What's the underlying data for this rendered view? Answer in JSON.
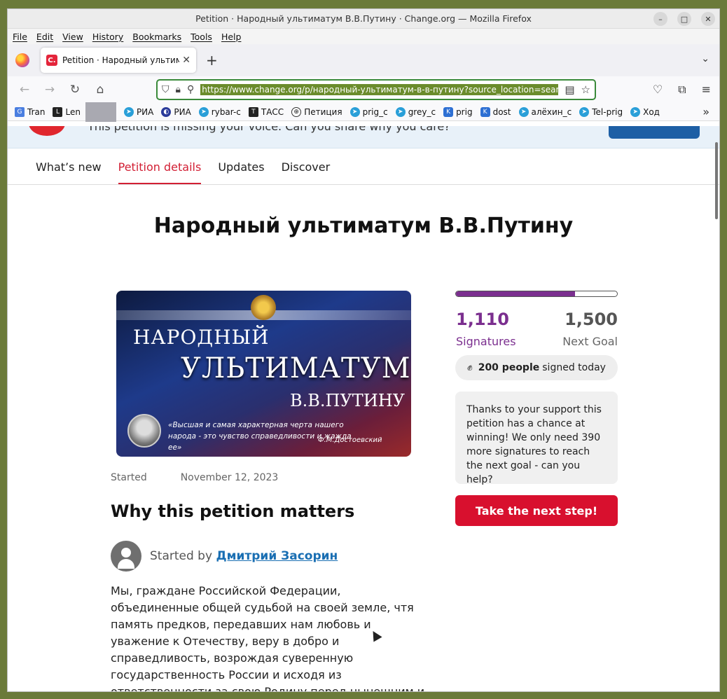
{
  "window": {
    "title": "Petition · Народный ультиматум В.В.Путину · Change.org — Mozilla Firefox"
  },
  "menu": [
    "File",
    "Edit",
    "View",
    "History",
    "Bookmarks",
    "Tools",
    "Help"
  ],
  "tab": {
    "title": "Petition · Народный ультимат"
  },
  "urlbar": {
    "url": "https://www.change.org/p/народный-ультиматум-в-в-путину?source_location=sear"
  },
  "bookmarks": [
    {
      "label": "Tran",
      "icon": "google-translate-icon"
    },
    {
      "label": "Len",
      "icon": "l-icon"
    },
    {
      "label": "РИА",
      "icon": "telegram-icon"
    },
    {
      "label": "РИА",
      "icon": "ria-icon"
    },
    {
      "label": "rybar-c",
      "icon": "telegram-icon"
    },
    {
      "label": "ТАСС",
      "icon": "tass-icon"
    },
    {
      "label": "Петиция",
      "icon": "globe-icon"
    },
    {
      "label": "prig_c",
      "icon": "telegram-icon"
    },
    {
      "label": "grey_c",
      "icon": "telegram-icon"
    },
    {
      "label": "prig",
      "icon": "vk-icon"
    },
    {
      "label": "dost",
      "icon": "vk-icon"
    },
    {
      "label": "алёхин_с",
      "icon": "telegram-icon"
    },
    {
      "label": "Tel-prig",
      "icon": "telegram-icon"
    },
    {
      "label": "Ход",
      "icon": "telegram-icon"
    }
  ],
  "banner": {
    "text": "This petition is missing your voice. Can you share why you care?"
  },
  "nav": {
    "whats_new": "What’s new",
    "details": "Petition details",
    "updates": "Updates",
    "discover": "Discover"
  },
  "petition": {
    "title": "Народный ультиматум В.В.Путину",
    "image": {
      "line1": "НАРОДНЫЙ",
      "line2": "УЛЬТИМАТУМ",
      "line3": "В.В.ПУТИНУ",
      "quote": "«Высшая и самая характерная черта нашего народа - это чувство справедливости и жажда ее»",
      "quote_author": "Ф.М.Достоевский"
    },
    "started_label": "Started",
    "started_date": "November 12, 2023",
    "why_heading": "Why this petition matters",
    "started_by": "Started by",
    "author": "Дмитрий Засорин",
    "body": "Мы, граждане Российской Федерации, объединенные общей судьбой на своей земле, чтя память предков, передавших нам любовь и уважение к Отечеству, веру в добро и справедливость, возрождая суверенную государственность России и исходя из ответственности за свою Родину перед нынешним и будущими поколениями, помня заслуги Героев"
  },
  "sidebar": {
    "signatures": "1,110",
    "signatures_value": 1110,
    "goal": "1,500",
    "goal_value": 1500,
    "progress_fraction": 0.74,
    "signatures_label": "Signatures",
    "goal_label": "Next Goal",
    "today_count": "200 people",
    "today_text": "signed today",
    "support_text": "Thanks to your support this petition has a chance at winning! We only need 390 more signatures to reach the next goal - can you help?",
    "cta": "Take the next step!"
  },
  "colors": {
    "brand_red": "#d8102e",
    "signature_purple": "#7b2f8f",
    "link_blue": "#1a6fb3"
  }
}
